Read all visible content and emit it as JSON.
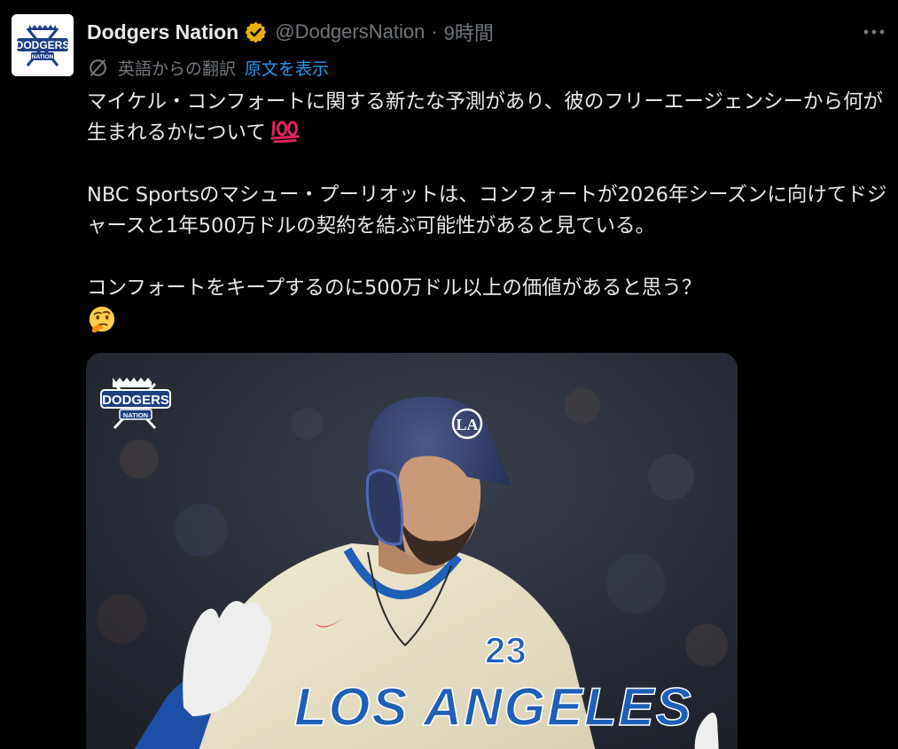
{
  "tweet": {
    "author": {
      "display_name": "Dodgers Nation",
      "handle": "@DodgersNation",
      "verified": true,
      "avatar_text": "DODGERS NATION"
    },
    "timestamp": "9時間",
    "separator": "·",
    "more_icon": "more-horizontal-icon",
    "translation": {
      "label": "英語からの翻訳",
      "link": "原文を表示",
      "icon": "translate-icon"
    },
    "paragraphs": [
      "マイケル・コンフォートに関する新たな予測があり、彼のフリーエージェンシーから何が生まれるかについて",
      "NBC Sportsのマシュー・プーリオットは、コンフォートが2026年シーズンに向けてドジャースと1年500万ドルの契約を結ぶ可能性があると見ている。",
      "コンフォートをキープするのに500万ドル以上の価値があると思う？"
    ],
    "emojis": {
      "hundred": "hundred-points-emoji",
      "thinking": "thinking-face-emoji"
    },
    "media": {
      "watermark_text": "DODGERS NATION",
      "helmet_logo": "LA",
      "jersey_number": "23",
      "jersey_text": "LOS ANGELES",
      "colors": {
        "background": "#242833",
        "jersey": "#e9e2c9",
        "jersey_blue": "#1e5fb8",
        "helmet": "#2c3a63"
      }
    }
  }
}
